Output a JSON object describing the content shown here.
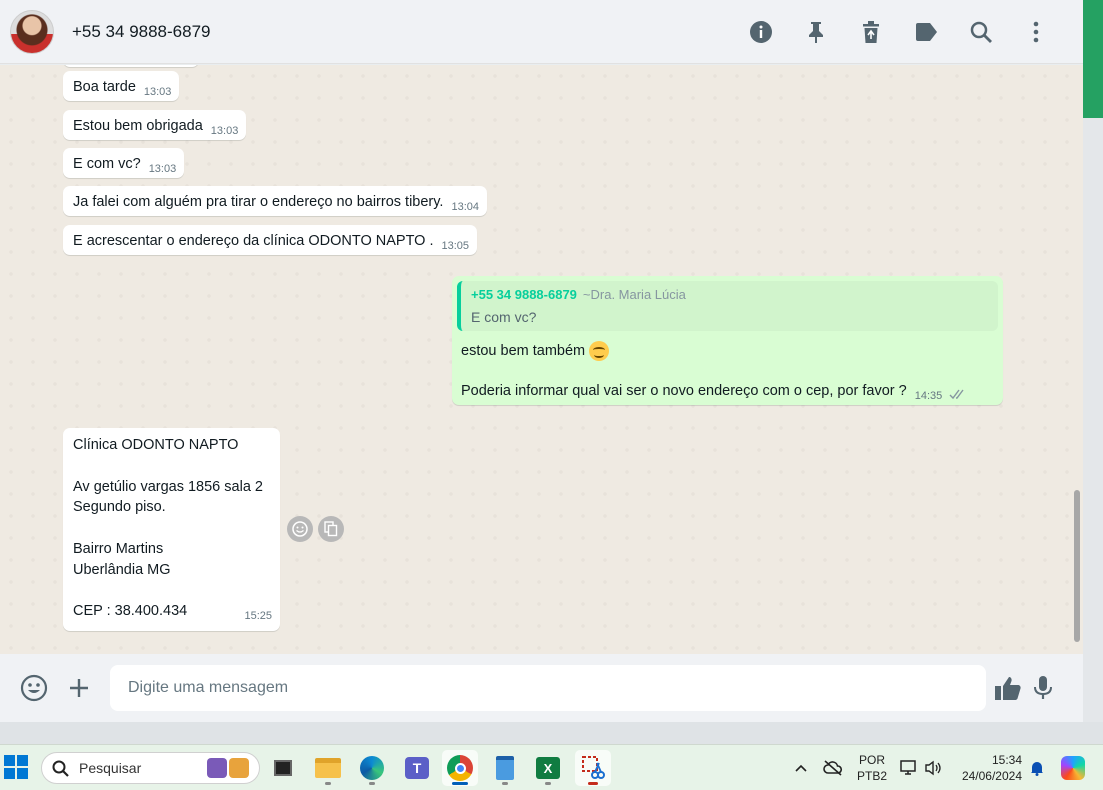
{
  "header": {
    "contact_name": "+55 34 9888-6879",
    "icons": [
      "info-icon",
      "pin-icon",
      "delete-icon",
      "label-icon",
      "search-icon",
      "more-options-icon"
    ]
  },
  "messages": [
    {
      "id": "m1",
      "direction": "in",
      "text": "Boa tarde",
      "time": "13:03"
    },
    {
      "id": "m2",
      "direction": "in",
      "text": "Estou bem obrigada",
      "time": "13:03"
    },
    {
      "id": "m3",
      "direction": "in",
      "text": "E com vc?",
      "time": "13:03"
    },
    {
      "id": "m4",
      "direction": "in",
      "text": "Ja falei com alguém pra tirar o endereço no bairros tibery.",
      "time": "13:04"
    },
    {
      "id": "m5",
      "direction": "in",
      "text": "E acrescentar o endereço da clínica ODONTO NAPTO .",
      "time": "13:05"
    },
    {
      "id": "m6",
      "direction": "out",
      "quote": {
        "name": "+55 34 9888-6879",
        "alias": "~Dra. Maria Lúcia",
        "text": "E com vc?"
      },
      "line1": "estou bem também",
      "line2": "Poderia informar qual vai ser o novo endereço com o cep, por favor ?",
      "time": "14:35",
      "status": "read"
    },
    {
      "id": "m7",
      "direction": "in",
      "lines": [
        "Clínica ODONTO NAPTO",
        "",
        "Av getúlio vargas 1856 sala 2",
        "Segundo piso.",
        "",
        "Bairro Martins",
        "Uberlândia MG",
        "",
        "CEP : 38.400.434"
      ],
      "time": "15:25"
    }
  ],
  "composer": {
    "placeholder": "Digite uma mensagem"
  },
  "taskbar": {
    "search_label": "Pesquisar",
    "language_line1": "POR",
    "language_line2": "PTB2",
    "clock_time": "15:34",
    "clock_date": "24/06/2024"
  },
  "colors": {
    "accent_green": "#25a162",
    "outgoing_bubble": "#d9fdd3",
    "quote_name": "#06cf9c"
  }
}
